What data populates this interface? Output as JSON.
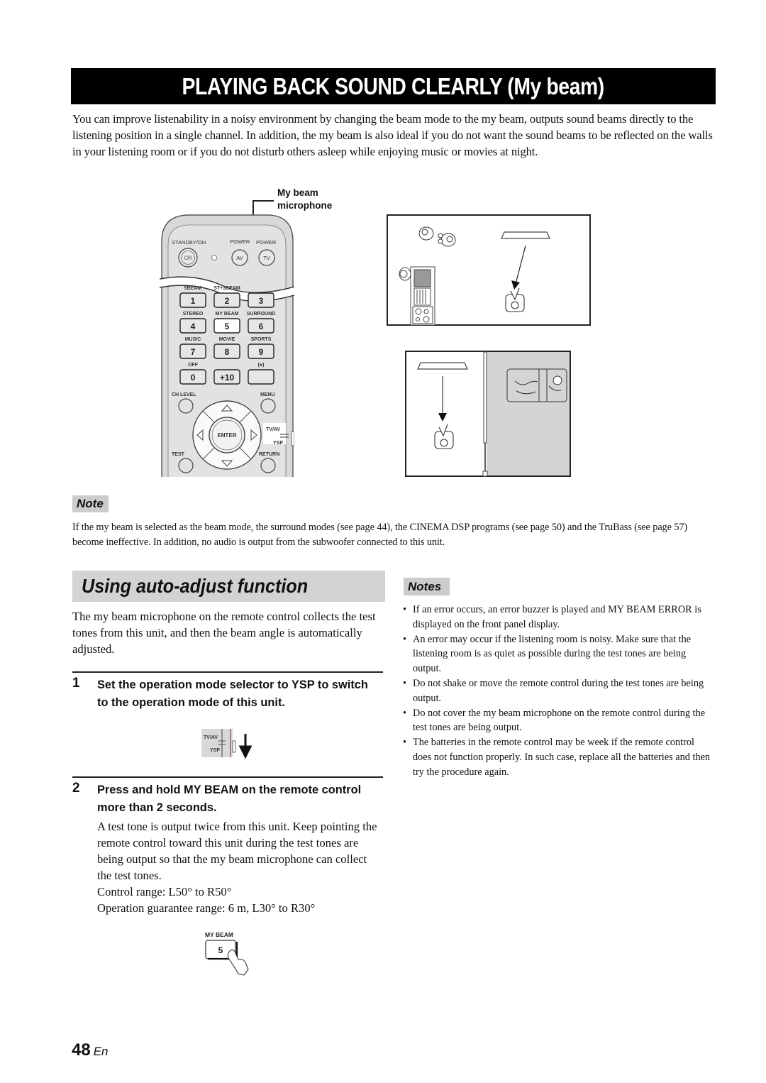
{
  "title": "PLAYING BACK SOUND CLEARLY (My beam)",
  "intro": "You can improve listenability in a noisy environment by changing the beam mode to the my beam, outputs sound beams directly to the listening position in a single channel. In addition, the my beam is also ideal if you do not want the sound beams to be reflected on the walls in your listening room or if you do not disturb others asleep while enjoying music or movies at night.",
  "remote_figure": {
    "callout_line1": "My beam",
    "callout_line2": "microphone",
    "labels": {
      "standby": "STANDBY/ON",
      "power_av": "POWER",
      "power_tv": "POWER",
      "av": "AV",
      "tv": "TV",
      "standby_symbol": "⏻/I",
      "ch_level": "CH LEVEL",
      "menu": "MENU",
      "test": "TEST",
      "return": "RETURN",
      "enter": "ENTER",
      "tvav": "TV/AV",
      "ysp": "YSP"
    },
    "button_rows": [
      [
        {
          "label": "5BEAM",
          "key": "1"
        },
        {
          "label": "ST+3BEAM",
          "key": "2"
        },
        {
          "label": "",
          "key": "3"
        }
      ],
      [
        {
          "label": "STEREO",
          "key": "4"
        },
        {
          "label": "MY BEAM",
          "key": "5"
        },
        {
          "label": "SURROUND",
          "key": "6"
        }
      ],
      [
        {
          "label": "MUSIC",
          "key": "7"
        },
        {
          "label": "MOVIE",
          "key": "8"
        },
        {
          "label": "SPORTS",
          "key": "9"
        }
      ],
      [
        {
          "label": "OFF",
          "key": "0"
        },
        {
          "label": "",
          "key": "+10"
        },
        {
          "label": "(●)",
          "key": ""
        }
      ]
    ]
  },
  "note": {
    "label": "Note",
    "text": "If the my beam is selected as the beam mode, the surround modes (see page 44), the CINEMA DSP programs (see page 50) and the TruBass (see page 57) become ineffective. In addition, no audio is output from the subwoofer connected to this unit."
  },
  "section": {
    "heading": "Using auto-adjust function",
    "intro": "The my beam microphone on the remote control collects the test tones from this unit, and then the beam angle is automatically adjusted.",
    "steps": [
      {
        "number": "1",
        "title": "Set the operation mode selector to YSP to switch to the operation mode of this unit.",
        "body": [],
        "figure": {
          "tvav": "TV/AV",
          "ysp": "YSP"
        }
      },
      {
        "number": "2",
        "title": "Press and hold MY BEAM on the remote control more than 2 seconds.",
        "body": [
          "A test tone is output twice from this unit. Keep pointing the remote control toward this unit during the test tones are being output so that the my beam microphone can collect the test tones.",
          "Control range: L50° to R50°",
          "Operation guarantee range: 6 m, L30° to R30°"
        ],
        "figure": {
          "label": "MY BEAM",
          "key": "5"
        }
      }
    ]
  },
  "notes": {
    "label": "Notes",
    "items": [
      "If an error occurs, an error buzzer is played and MY BEAM ERROR is displayed on the front panel display.",
      "An error may occur if the listening room is noisy. Make sure that the listening room is as quiet as possible during the test tones are being output.",
      "Do not shake or move the remote control during the test tones are being output.",
      "Do not cover the my beam microphone on the remote control during the test tones are being output.",
      "The batteries in the remote control may be week if the remote control does not function properly. In such case, replace all the batteries and then try the procedure again."
    ]
  },
  "page": {
    "number": "48",
    "lang": "En"
  }
}
